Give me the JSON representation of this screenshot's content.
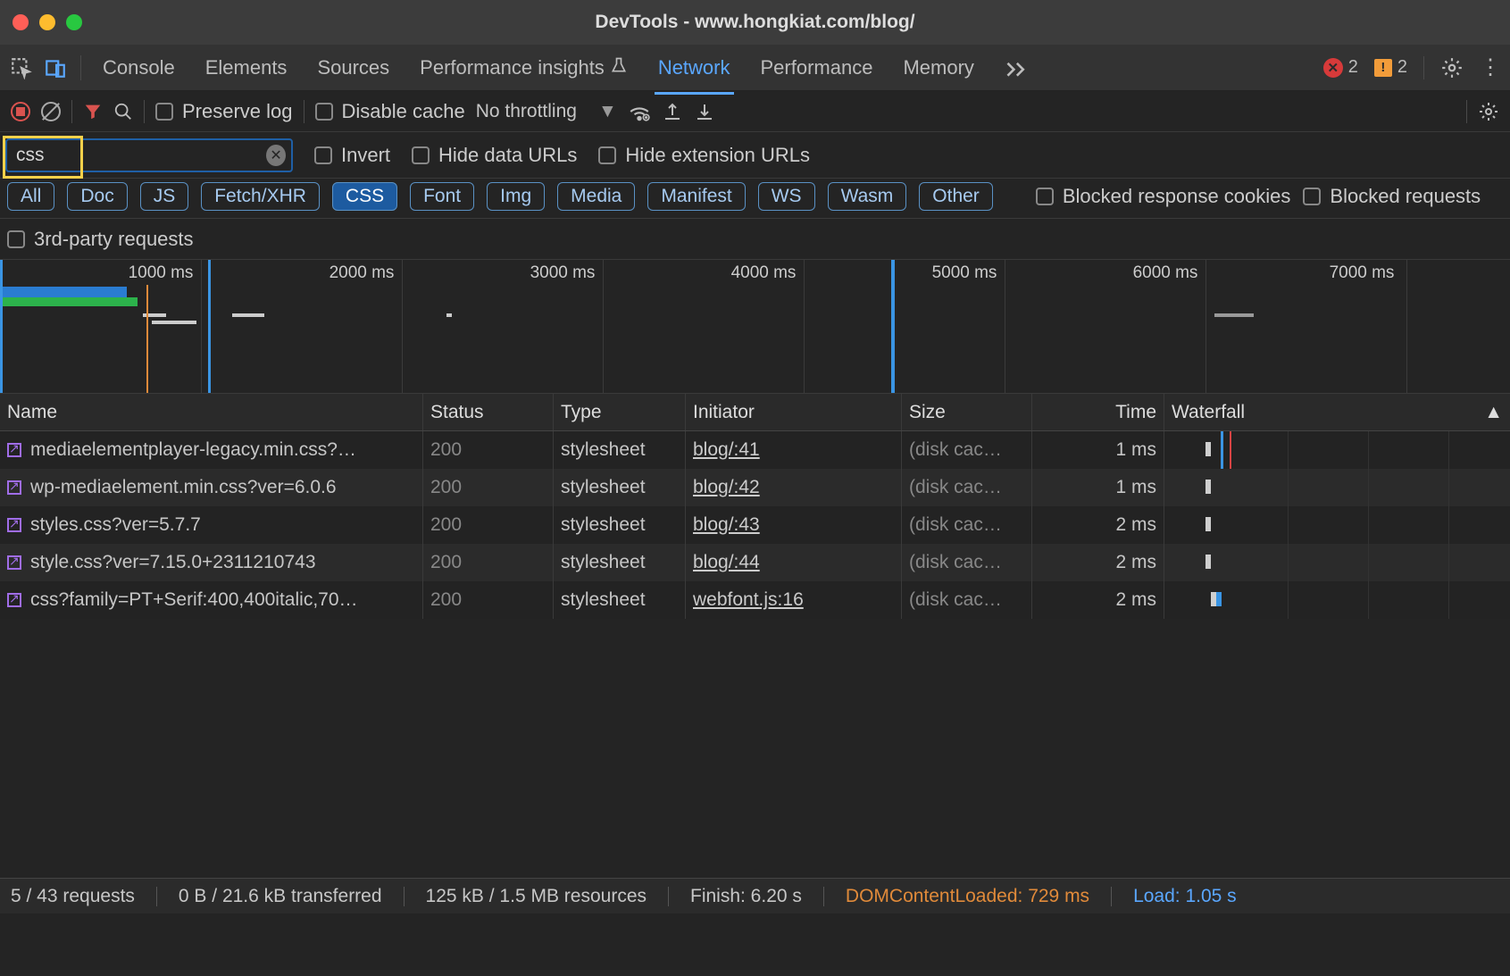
{
  "window": {
    "title": "DevTools - www.hongkiat.com/blog/"
  },
  "tabs": {
    "items": [
      "Console",
      "Elements",
      "Sources",
      "Performance insights",
      "Network",
      "Performance",
      "Memory"
    ],
    "active": "Network",
    "errors": "2",
    "warnings": "2"
  },
  "toolbar": {
    "preserve_log": "Preserve log",
    "disable_cache": "Disable cache",
    "throttling": "No throttling"
  },
  "filter": {
    "value": "css",
    "invert": "Invert",
    "hide_data_urls": "Hide data URLs",
    "hide_ext_urls": "Hide extension URLs"
  },
  "pills": [
    "All",
    "Doc",
    "JS",
    "Fetch/XHR",
    "CSS",
    "Font",
    "Img",
    "Media",
    "Manifest",
    "WS",
    "Wasm",
    "Other"
  ],
  "pills_active": "CSS",
  "pill_checks": {
    "blocked_cookies": "Blocked response cookies",
    "blocked_requests": "Blocked requests",
    "third_party": "3rd-party requests"
  },
  "timeline_ticks": [
    "1000 ms",
    "2000 ms",
    "3000 ms",
    "4000 ms",
    "5000 ms",
    "6000 ms",
    "7000 ms"
  ],
  "columns": [
    "Name",
    "Status",
    "Type",
    "Initiator",
    "Size",
    "Time",
    "Waterfall"
  ],
  "rows": [
    {
      "name": "mediaelementplayer-legacy.min.css?…",
      "status": "200",
      "type": "stylesheet",
      "initiator": "blog/:41",
      "size": "(disk cac…",
      "time": "1 ms"
    },
    {
      "name": "wp-mediaelement.min.css?ver=6.0.6",
      "status": "200",
      "type": "stylesheet",
      "initiator": "blog/:42",
      "size": "(disk cac…",
      "time": "1 ms"
    },
    {
      "name": "styles.css?ver=5.7.7",
      "status": "200",
      "type": "stylesheet",
      "initiator": "blog/:43",
      "size": "(disk cac…",
      "time": "2 ms"
    },
    {
      "name": "style.css?ver=7.15.0+2311210743",
      "status": "200",
      "type": "stylesheet",
      "initiator": "blog/:44",
      "size": "(disk cac…",
      "time": "2 ms"
    },
    {
      "name": "css?family=PT+Serif:400,400italic,70…",
      "status": "200",
      "type": "stylesheet",
      "initiator": "webfont.js:16",
      "size": "(disk cac…",
      "time": "2 ms"
    }
  ],
  "status": {
    "requests": "5 / 43 requests",
    "transferred": "0 B / 21.6 kB transferred",
    "resources": "125 kB / 1.5 MB resources",
    "finish": "Finish: 6.20 s",
    "domcl": "DOMContentLoaded: 729 ms",
    "load": "Load: 1.05 s"
  }
}
